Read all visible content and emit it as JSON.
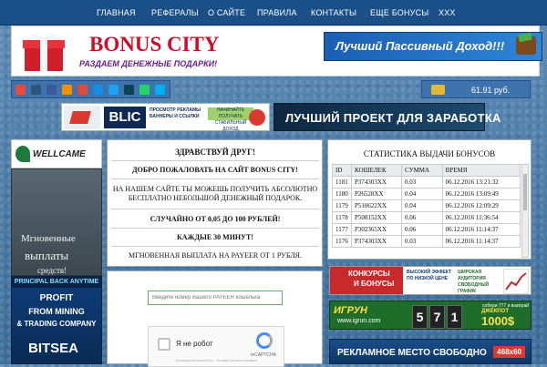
{
  "nav": {
    "items": [
      "ГЛАВНАЯ",
      "РЕФЕРАЛЫ",
      "О САЙТЕ",
      "ПРАВИЛА",
      "КОНТАКТЫ",
      "ЕЩЕ БОНУСЫ",
      "XXX"
    ]
  },
  "header": {
    "brand": "BONUS CITY",
    "tagline": "РАЗДАЕМ ДЕНЕЖНЫЕ ПОДАРКИ!",
    "banner": "Лучший Пассивный Доход!!!"
  },
  "social": {
    "icons": [
      "bookmark-icon",
      "vk-icon",
      "facebook-icon",
      "odnoklassniki-icon",
      "google-plus-icon",
      "mail-ru-icon",
      "twitter-icon",
      "livejournal-icon",
      "whatsapp-icon",
      "skype-icon"
    ],
    "colors": [
      "#e84a3c",
      "#2b587a",
      "#3b5998",
      "#f39200",
      "#dd4b39",
      "#168de2",
      "#1da1f2",
      "#0d425a",
      "#25d366",
      "#00aff0"
    ]
  },
  "balance": {
    "value": "61.91 руб."
  },
  "ads": {
    "blic": {
      "brand": "BLIC",
      "text1": "ПРОСМОТР РЕКЛАМЫ БАННЕРЫ И ССЫЛКИ",
      "text2": "НАЧИНАЙТЕ ПОЛУЧАТЬ СТАБИЛЬНЫЙ ДОХОД"
    },
    "best_project": "ЛУЧШИЙ ПРОЕКТ ДЛЯ ЗАРАБОТКА",
    "wellcame": "WELLCAME",
    "payout_lines": [
      "Мгновенные",
      "выплаты",
      "средств!"
    ],
    "bitsea": {
      "caption": "PRINCIPAL BACK ANYTIME",
      "line1": "PROFIT",
      "line2": "FROM MINING",
      "line3": "& TRADING COMPANY",
      "logo": "BITSEA"
    },
    "konkursy": {
      "line1": "КОНКУРСЫ",
      "line2": "И БОНУСЫ",
      "mid": "ВЫСОКИЙ ЭФФЕКТ ПО НИЗКОЙ ЦЕНЕ",
      "mid2": "ШИРОКАЯ АУДИТОРИЯ СВОБОДНЫЙ ГРАФИК"
    },
    "igrun": {
      "logo": "ИГРУН",
      "url": "www.igrun.com",
      "digits": [
        "5",
        "7",
        "1"
      ],
      "jackpot_small": "собери 777 и выиграй",
      "jackpot_label": "ДЖЕКПОТ",
      "jackpot_value": "1000$"
    },
    "free": {
      "text": "РЕКЛАМНОЕ МЕСТО СВОБОДНО",
      "size": "468x60"
    }
  },
  "center": {
    "greeting": "ЗДРАВСТВУЙ ДРУГ!",
    "welcome": "ДОБРО ПОЖАЛОВАТЬ НА САЙТ BONUS CITY!",
    "desc": "НА НАШЕМ САЙТЕ ТЫ МОЖЕШЬ ПОЛУЧИТЬ АБСОЛЮТНО БЕСПЛАТНО НЕБОЛЬШОЙ ДЕНЕЖНЫЙ ПОДАРОК.",
    "range": "СЛУЧАЙНО ОТ 0,05 ДО 100 РУБЛЕЙ!",
    "interval": "КАЖДЫЕ 30 МИНУТ!",
    "payout": "МГНОВЕННАЯ ВЫПЛАТА НА PAYEER ОТ 1 РУБЛЯ."
  },
  "form": {
    "payeer_placeholder": "Введите номер Вашего PAYEER кошелька",
    "captcha_label": "Я не робот",
    "captcha_brand": "reCAPTCHA",
    "captcha_footer": "Конфиденциальность - Условия использования"
  },
  "stats": {
    "title": "СТАТИСТИКА ВЫДАЧИ БОНУСОВ",
    "headers": [
      "ID",
      "КОШЕЛЕК",
      "СУММА",
      "ВРЕМЯ"
    ],
    "rows": [
      [
        "1181",
        "P374303XX",
        "0.03",
        "06.12.2016 13:21:32"
      ],
      [
        "1180",
        "P26528XX",
        "0.04",
        "06.12.2016 13:09:49"
      ],
      [
        "1179",
        "P510622XX",
        "0.04",
        "06.12.2016 12:09:29"
      ],
      [
        "1178",
        "P508152XX",
        "0.06",
        "06.12.2016 11:36:54"
      ],
      [
        "1177",
        "P302365XX",
        "0.06",
        "06.12.2016 11:14:37"
      ],
      [
        "1176",
        "P374303XX",
        "0.03",
        "06.12.2016 11:14:37"
      ]
    ]
  }
}
